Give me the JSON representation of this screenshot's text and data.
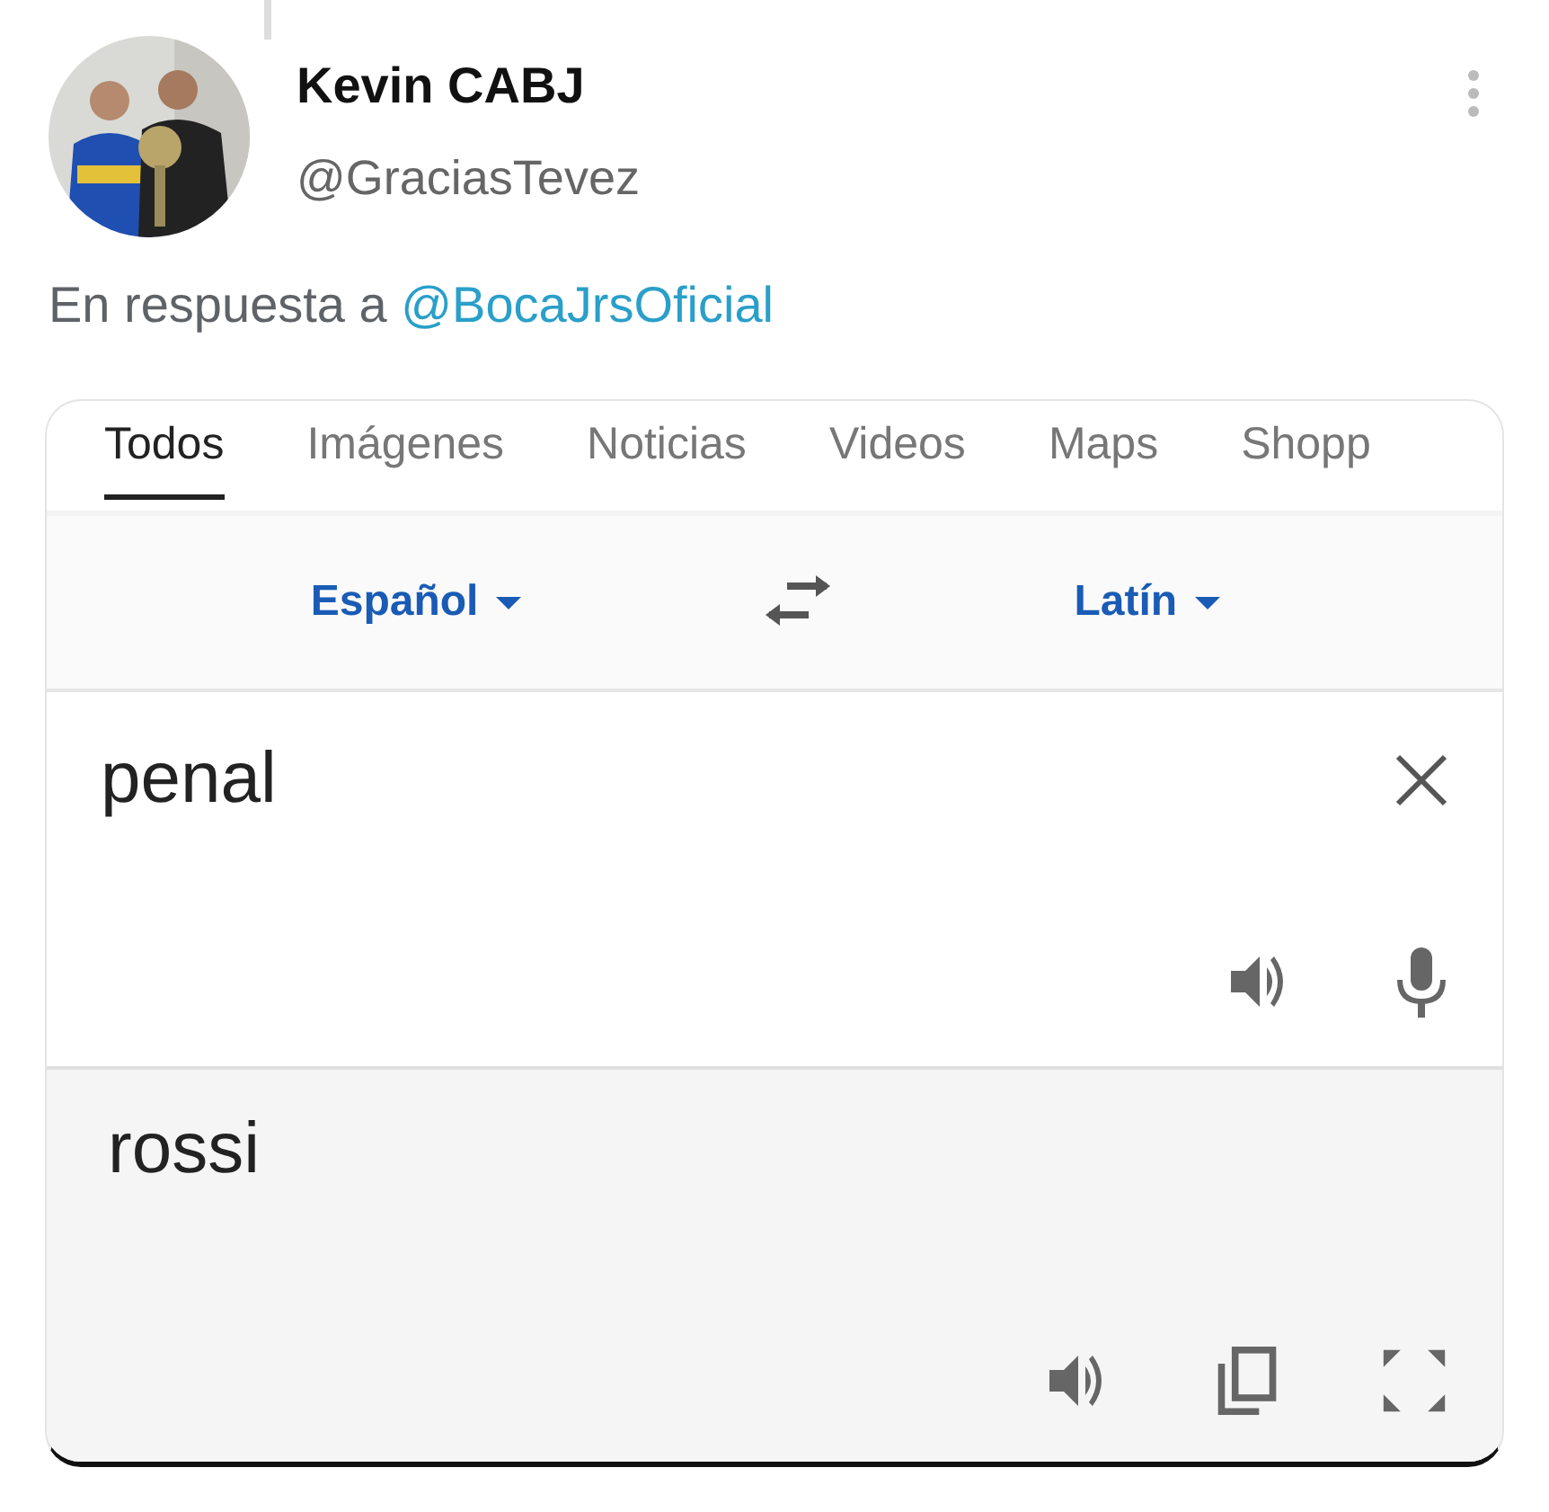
{
  "tweet": {
    "author": {
      "name": "Kevin CABJ",
      "handle": "@GraciasTevez"
    },
    "reply_to": {
      "prefix": "En respuesta a",
      "mention": "@BocaJrsOficial"
    }
  },
  "translate_card": {
    "tabs": [
      {
        "label": "Todos",
        "selected": true
      },
      {
        "label": "Imágenes",
        "selected": false
      },
      {
        "label": "Noticias",
        "selected": false
      },
      {
        "label": "Videos",
        "selected": false
      },
      {
        "label": "Maps",
        "selected": false
      },
      {
        "label": "Shopp",
        "selected": false
      }
    ],
    "source_language": "Español",
    "target_language": "Latín",
    "input": {
      "value": "penal"
    },
    "output": {
      "text": "rossi"
    }
  }
}
